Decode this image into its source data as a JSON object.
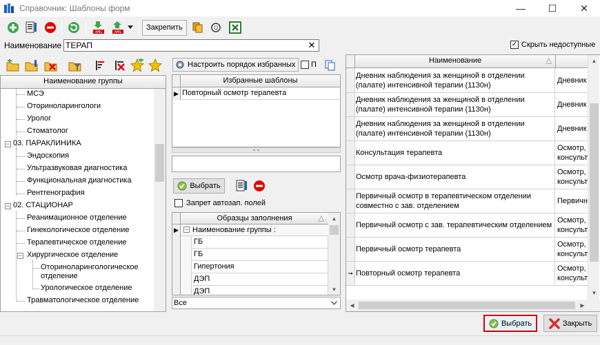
{
  "window": {
    "title": "Справочник: Шаблоны форм",
    "minimize": "—",
    "maximize": "☐",
    "close": "✕"
  },
  "toolbar": {
    "pin_label": "Закрепить"
  },
  "search": {
    "label": "Наименование",
    "value": "ТЕРАП",
    "clear": "✕"
  },
  "hide_unavailable": {
    "label": "Скрыть недоступные",
    "checked": "✓"
  },
  "groups": {
    "header": "Наименование группы",
    "items": [
      "МСЭ",
      "Оториноларингологи",
      "Уролог",
      "Стоматолог",
      "03. ПАРАКЛИНИКА",
      "Эндоскопия",
      "Ультразвуковая диагностика",
      "Функциональная диагностика",
      "Рентгенография",
      "02. СТАЦИОНАР",
      "Реанимационное отделение",
      "Гинекологическое отделение",
      "Терапевтическое отделение",
      "Хирургическое отделение",
      "Оториноларингологическое",
      "отделение",
      "Урологическое отделение",
      "Травматологическое отделение"
    ],
    "expander_minus": "−"
  },
  "favorites": {
    "configure_label": "Настроить порядок избранных",
    "p_label": "П",
    "header": "Избранные шаблоны",
    "rows": [
      "Повторный осмотр терапевта"
    ],
    "row_indicator": "▶",
    "splitter": "⌄⌄"
  },
  "select_btn": {
    "label": "Выбрать"
  },
  "autofill": {
    "label": "Запрет автозап. полей"
  },
  "samples": {
    "header": "Образцы заполнения",
    "sort_icon": "△",
    "group_header": "Наименование группы :",
    "group_expander": "−",
    "rows": [
      "ГБ",
      "ГБ",
      "Гипертония",
      "ДЭП",
      "ДЭП"
    ],
    "filter_value": "Все"
  },
  "main_table": {
    "header": "Наименование",
    "sort_icon": "△",
    "rows": [
      {
        "name": "Дневник наблюдения за женщиной в отделении (палате) интенсивной терапии (1130н)",
        "col2": "Дневник"
      },
      {
        "name": "Дневник наблюдения за женщиной в отделении (палате) интенсивной терапии (1130н)",
        "col2": "Дневник"
      },
      {
        "name": "Дневник наблюдения за женщиной в отделении (палате) интенсивной терапии (1130н)",
        "col2": "Дневник"
      },
      {
        "name": "Консультация терапевта",
        "col2": "Осмотр, консульт"
      },
      {
        "name": "Осмотр врача-физиотерапевта",
        "col2": "Осмотр, консульт"
      },
      {
        "name": "Первичный осмотр в терапевтическом отделении совместно с зав. отделением",
        "col2": "Первичн"
      },
      {
        "name": "Первичный осмотр с зав. терапевтическим отделением",
        "col2": "Осмотр, консульт"
      },
      {
        "name": "Первичный осмотр терапевта",
        "col2": "Осмотр, консульт"
      },
      {
        "name": "Повторный осмотр терапевта",
        "col2": "Осмотр, консульт"
      }
    ],
    "current_row_indicator": "➞"
  },
  "footer": {
    "select_label": "Выбрать",
    "close_label": "Закрыть"
  },
  "scroll": {
    "up": "▲",
    "down": "▼",
    "left": "◀",
    "right": "▶"
  },
  "colors": {
    "accent_red": "#e00000",
    "green": "#3aa64a",
    "selected_focus": "#d40000"
  }
}
